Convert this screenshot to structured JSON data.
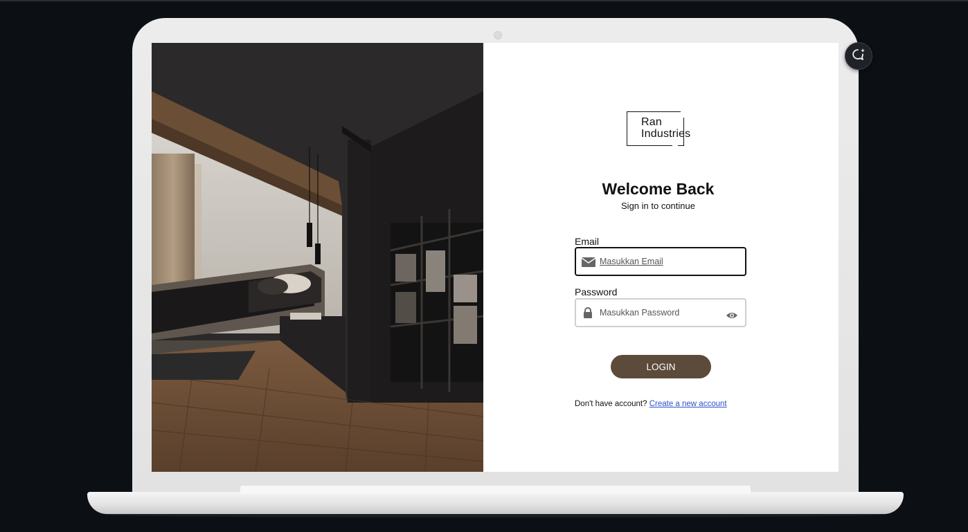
{
  "brand": {
    "line1": "Ran",
    "line2": "Industries"
  },
  "heading": {
    "title": "Welcome Back",
    "subtitle": "Sign in to continue"
  },
  "form": {
    "email_label": "Email",
    "email_placeholder": "Masukkan Email",
    "password_label": "Password",
    "password_placeholder": "Masukkan Password",
    "login_label": "LOGIN"
  },
  "footer": {
    "prompt": "Don't have account?",
    "link": "Create a new account"
  },
  "icons": {
    "email": "envelope-icon",
    "password": "lock-icon",
    "toggle": "eye-icon",
    "chat": "chat-sparkle-icon"
  },
  "colors": {
    "accent": "#5c4a3a",
    "link": "#2c52c8",
    "background": "#0c1014"
  }
}
